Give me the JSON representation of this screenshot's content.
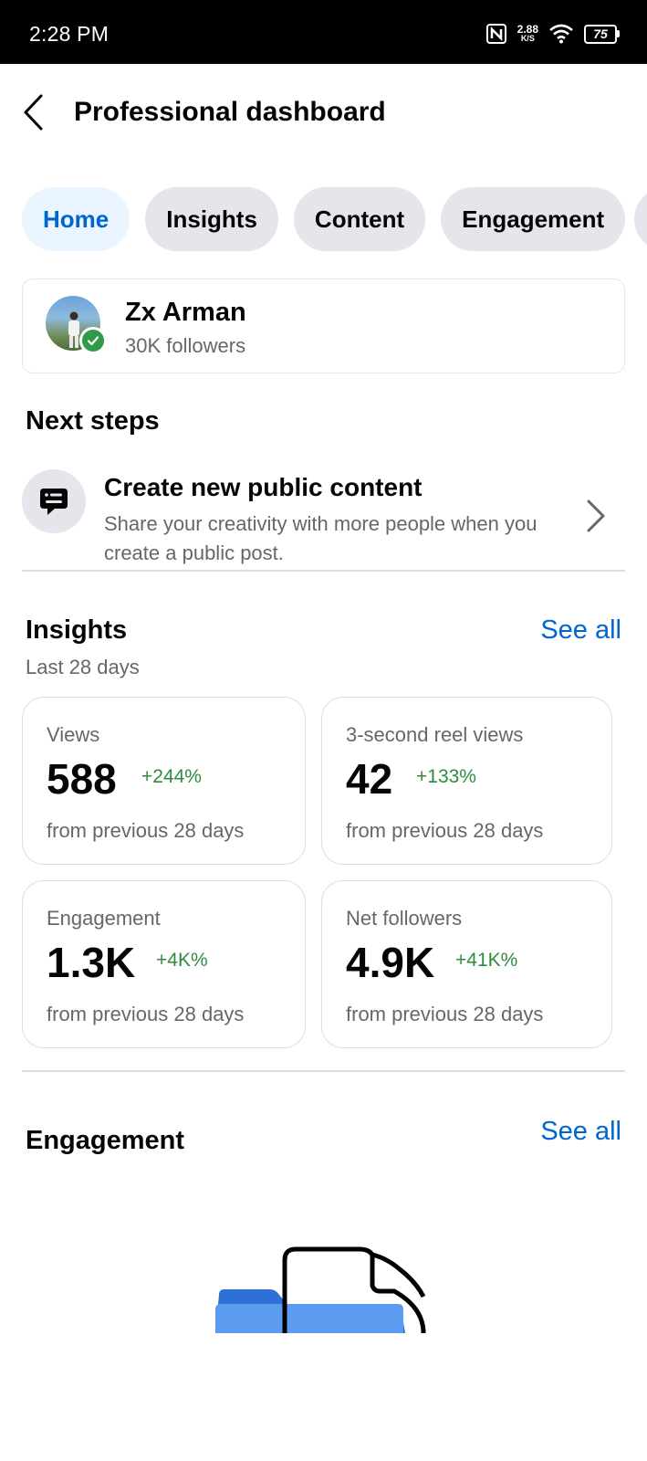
{
  "status_bar": {
    "time": "2:28 PM",
    "net_speed_value": "2.88",
    "net_speed_unit": "K/S",
    "battery": "75",
    "icons": [
      "nfc-icon",
      "wifi-icon",
      "battery-icon"
    ]
  },
  "header": {
    "title": "Professional dashboard",
    "back_icon": "chevron-left-icon"
  },
  "tabs": [
    {
      "label": "Home",
      "active": true
    },
    {
      "label": "Insights",
      "active": false
    },
    {
      "label": "Content",
      "active": false
    },
    {
      "label": "Engagement",
      "active": false
    }
  ],
  "profile": {
    "name": "Zx Arman",
    "followers": "30K followers",
    "verified": true
  },
  "next_steps": {
    "title": "Next steps",
    "item": {
      "icon": "message-post-icon",
      "title": "Create new public content",
      "description": "Share your creativity with more people when you create a public post."
    }
  },
  "insights": {
    "title": "Insights",
    "see_all": "See all",
    "subtitle": "Last 28 days",
    "cards": [
      {
        "label": "Views",
        "value": "588",
        "delta": "+244%",
        "footnote": "from previous 28 days"
      },
      {
        "label": "3-second reel views",
        "value": "42",
        "delta": "+133%",
        "footnote": "from previous 28 days"
      },
      {
        "label": "Engagement",
        "value": "1.3K",
        "delta": "+4K%",
        "footnote": "from previous 28 days"
      },
      {
        "label": "Net followers",
        "value": "4.9K",
        "delta": "+41K%",
        "footnote": "from previous 28 days"
      }
    ]
  },
  "engagement": {
    "title": "Engagement",
    "see_all": "See all",
    "illustration": "folder-document-icon"
  },
  "colors": {
    "accent": "#0064d1",
    "positive": "#2e8b3e",
    "secondary_text": "#65676b",
    "chip_bg": "#e4e6eb",
    "active_chip_bg": "#ebf5ff"
  }
}
